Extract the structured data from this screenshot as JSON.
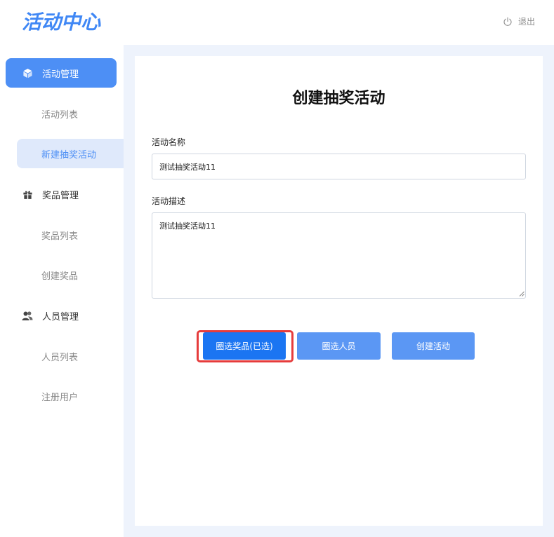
{
  "header": {
    "logo": "活动中心",
    "logout_label": "退出"
  },
  "sidebar": {
    "groups": [
      {
        "label": "活动管理",
        "icon": "cube-icon",
        "active": true
      },
      {
        "label": "奖品管理",
        "icon": "gift-icon",
        "active": false
      },
      {
        "label": "人员管理",
        "icon": "users-icon",
        "active": false
      }
    ],
    "items": [
      {
        "label": "活动列表"
      },
      {
        "label": "新建抽奖活动"
      },
      {
        "label": "奖品列表"
      },
      {
        "label": "创建奖品"
      },
      {
        "label": "人员列表"
      },
      {
        "label": "注册用户"
      }
    ]
  },
  "form": {
    "title": "创建抽奖活动",
    "name_label": "活动名称",
    "name_value": "测试抽奖活动11",
    "desc_label": "活动描述",
    "desc_value": "测试抽奖活动11"
  },
  "buttons": {
    "select_prize": "圈选奖品(已选)",
    "select_people": "圈选人员",
    "create": "创建活动"
  },
  "colors": {
    "accent": "#4d8ff5",
    "primary_button": "#1b75f2",
    "secondary_button": "#5b97f4",
    "highlight": "#e63c3c",
    "content_bg": "#eef3fc"
  }
}
